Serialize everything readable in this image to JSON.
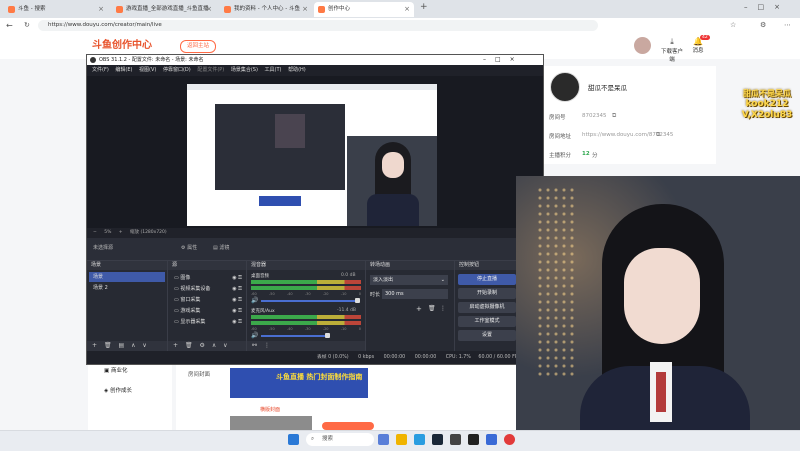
{
  "browser": {
    "tabs": [
      {
        "title": "斗鱼 - 搜索",
        "active": false
      },
      {
        "title": "游戏直播_全部游戏直播_斗鱼直播",
        "active": false
      },
      {
        "title": "我的资料 - 个人中心 - 斗鱼",
        "active": false
      },
      {
        "title": "创作中心",
        "active": true
      }
    ],
    "new_tab": "+",
    "url": "https://www.douyu.com/creator/main/live"
  },
  "site": {
    "logo_text": "斗鱼创作中心",
    "back_button": "返回主站",
    "download_label": "下载客户端",
    "messages_label": "消息",
    "messages_badge": "42"
  },
  "profile": {
    "name": "甜瓜不是呆瓜",
    "room_no_label": "房间号",
    "room_no": "8702345",
    "room_url_label": "房间地址",
    "room_url": "https://www.douyu.com/8702345",
    "points_label": "主播积分",
    "points": "12",
    "points_unit": "分"
  },
  "page_nav": {
    "items": [
      "商业化",
      "创作成长"
    ]
  },
  "page_content": {
    "cover_label": "房间封面",
    "banner_text": "斗鱼直播 热门封面制作指南",
    "preview_label": "横版封面"
  },
  "obs": {
    "title": "OBS 31.1.2 - 配置文件: 未命名 - 场景: 未命名",
    "menu": [
      "文件(F)",
      "编辑(E)",
      "视图(V)",
      "停靠窗口(D)",
      "配置文件(P)",
      "场景集合(S)",
      "工具(T)",
      "帮助(H)"
    ],
    "zoom": "5%",
    "canvas_info": "缩放 (1280x720)",
    "no_source": "未选择源",
    "properties": "属性",
    "filters": "滤镜",
    "scenes_title": "场景",
    "scenes": [
      "场景",
      "场景 2"
    ],
    "sources_title": "源",
    "sources": [
      "图像",
      "视频采集设备",
      "窗口采集",
      "游戏采集",
      "显示器采集"
    ],
    "mixer_title": "混音器",
    "mixer": [
      {
        "name": "桌面音频",
        "db": "0.0 dB"
      },
      {
        "name": "麦克风/Aux",
        "db": "-11.4 dB"
      }
    ],
    "mixer_scale": [
      "-60",
      "-55",
      "-50",
      "-45",
      "-40",
      "-35",
      "-30",
      "-25",
      "-20",
      "-15",
      "-10",
      "-5",
      "0"
    ],
    "transitions_title": "转场动画",
    "transition": "淡入淡出",
    "duration_label": "时长",
    "duration": "300 ms",
    "controls_title": "控制按钮",
    "controls": [
      "停止直播",
      "开始录制",
      "启动虚拟摄像机",
      "工作室模式",
      "设置"
    ],
    "status": {
      "frames": "丢帧 0 (0.0%)",
      "bitrate": "0 kbps",
      "live_time": "00:00:00",
      "rec_time": "00:00:00",
      "cpu": "CPU: 1.7%",
      "fps": "60.00 / 60.00 FPS"
    }
  },
  "overlay": {
    "line1": "甜瓜不是呆瓜",
    "line2": "kook212",
    "line3": "V,X2olu83"
  },
  "taskbar": {
    "search_placeholder": "搜索"
  },
  "colors": {
    "brand_orange": "#ff6a45",
    "obs_bg": "#2b2e38",
    "obs_selected": "#3f5aa8",
    "meter_green": "#3fbf4f",
    "meter_yellow": "#d6c53a",
    "meter_red": "#d64a3a",
    "points_green": "#2fa84f"
  }
}
